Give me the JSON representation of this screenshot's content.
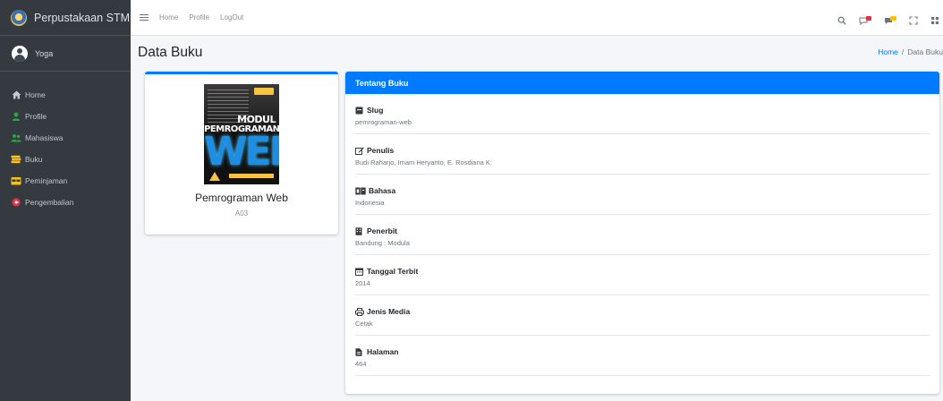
{
  "brand": {
    "title": "Perpustakaan STMIK"
  },
  "user": {
    "name": "Yoga"
  },
  "sidebar": {
    "items": [
      {
        "label": "Home",
        "icon": "home-icon",
        "color": "#c2c7d0"
      },
      {
        "label": "Profile",
        "icon": "user-icon",
        "color": "#28a745"
      },
      {
        "label": "Mahasiswa",
        "icon": "users-icon",
        "color": "#28a745"
      },
      {
        "label": "Buku",
        "icon": "books-icon",
        "color": "#ffc107"
      },
      {
        "label": "Peminjaman",
        "icon": "calendar-icon",
        "color": "#ffc107"
      },
      {
        "label": "Pengembalian",
        "icon": "return-icon",
        "color": "#dc3545"
      }
    ]
  },
  "topnav": {
    "home": "Home",
    "profile": "Profile",
    "logout": "LogOut"
  },
  "header": {
    "title": "Data Buku"
  },
  "breadcrumb": {
    "home": "Home",
    "separator": "/",
    "current": "Data Buku"
  },
  "book": {
    "title": "Pemrograman Web",
    "code": "A03",
    "cover": {
      "line1": "MODUL",
      "line2": "PEMROGRAMAN",
      "line3": "WEB"
    }
  },
  "info": {
    "header": "Tentang Buku",
    "rows": [
      {
        "label": "Slug",
        "value": "pemrograman-web",
        "icon": "bookmark-icon"
      },
      {
        "label": "Penulis",
        "value": "Budi Raharjo, Imam Heryanto, E. Rosdiana K.",
        "icon": "edit-icon"
      },
      {
        "label": "Bahasa",
        "value": "Indonesia",
        "icon": "language-icon"
      },
      {
        "label": "Penerbit",
        "value": "Bandung : Modula",
        "icon": "building-icon"
      },
      {
        "label": "Tanggal Terbit",
        "value": "2014",
        "icon": "calendar-icon"
      },
      {
        "label": "Jenis Media",
        "value": "Cetak",
        "icon": "print-icon"
      },
      {
        "label": "Halaman",
        "value": "464",
        "icon": "file-icon"
      }
    ]
  },
  "colors": {
    "primary": "#007bff",
    "sidebar": "#343a40",
    "background": "#f4f6f9"
  }
}
